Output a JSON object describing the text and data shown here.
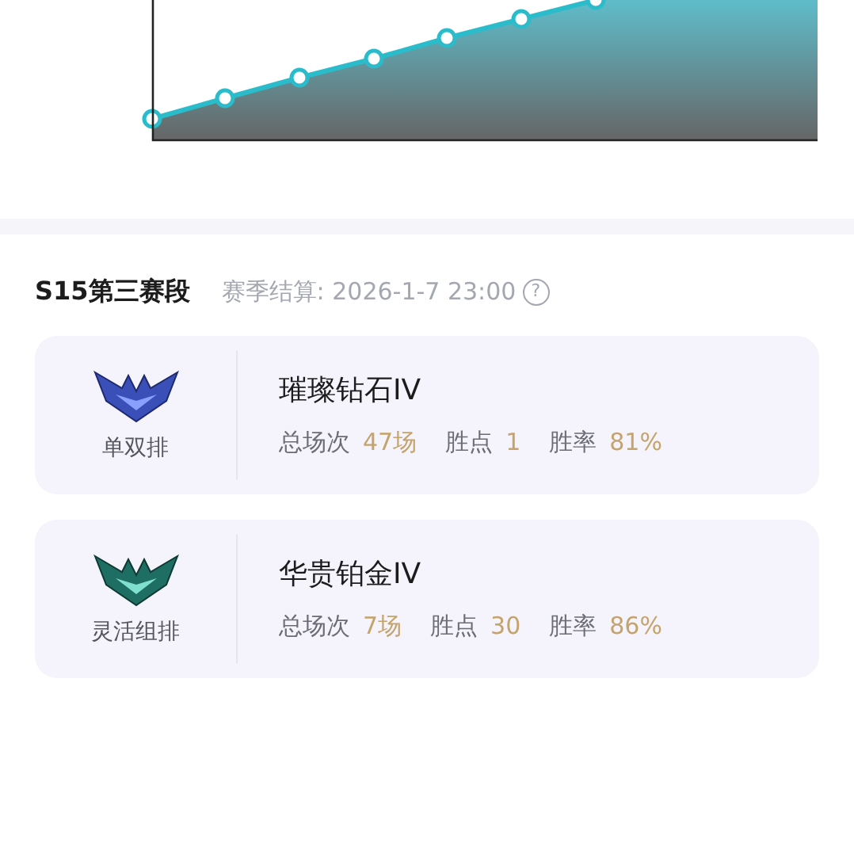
{
  "season": {
    "title": "S15第三赛段",
    "settlement": "赛季结算: 2026-1-7 23:00",
    "help_icon": "?"
  },
  "queues": [
    {
      "kind": "diamond",
      "queue": "单双排",
      "rank": "璀璨钻石IV",
      "stats": [
        {
          "label": "总场次",
          "value": "47场"
        },
        {
          "label": "胜点",
          "value": "1"
        },
        {
          "label": "胜率",
          "value": "81%"
        }
      ]
    },
    {
      "kind": "platinum",
      "queue": "灵活组排",
      "rank": "华贵铂金IV",
      "stats": [
        {
          "label": "总场次",
          "value": "7场"
        },
        {
          "label": "胜点",
          "value": "30"
        },
        {
          "label": "胜率",
          "value": "86%"
        }
      ]
    }
  ]
}
